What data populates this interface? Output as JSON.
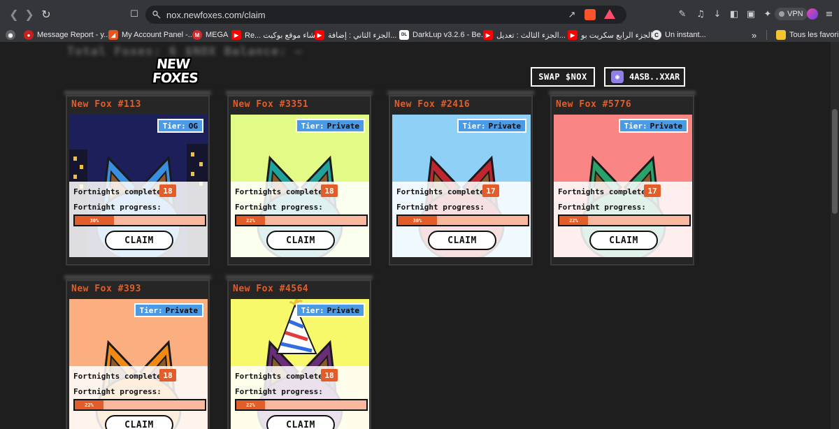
{
  "browser": {
    "url": "nox.newfoxes.com/claim",
    "vpn_label": "VPN",
    "bookmarks": [
      {
        "label": "Message Report - y...",
        "color": "#d93025",
        "glyph": "●"
      },
      {
        "label": "My Account Panel -...",
        "color": "#e8541d",
        "glyph": "◢"
      },
      {
        "label": "MEGA",
        "color": "#d9272e",
        "glyph": "M"
      },
      {
        "label": "Re... إنشاء موقع بوكيت",
        "color": "#ff0000",
        "glyph": "▶"
      },
      {
        "label": "الجزء الثاني : إضافة...",
        "color": "#ff0000",
        "glyph": "▶"
      },
      {
        "label": "DarkLup v3.2.6 - Be...",
        "color": "#ffffff",
        "glyph": "DL"
      },
      {
        "label": "الجزء الثالث : تعديل...",
        "color": "#ff0000",
        "glyph": "▶"
      },
      {
        "label": "الجزء الرابع سكريت بو...",
        "color": "#ff0000",
        "glyph": "▶"
      },
      {
        "label": "Un instant...",
        "color": "#e8e8e8",
        "glyph": "C"
      }
    ],
    "more_label": "»",
    "all_bookmarks_label": "Tous les favoris"
  },
  "header": {
    "blurred_text": "Total Foxes: 6  $NOX Balance: —",
    "logo_line1": "NEW",
    "logo_line2": "FOXES",
    "swap_label": "SWAP $NOX",
    "wallet_label": "4ASB..XXAR"
  },
  "labels": {
    "tier_prefix": "Tier:",
    "fortnights_completed": "Fortnights completed:",
    "fortnight_progress": "Fortnight progress:",
    "claim": "CLAIM"
  },
  "foxes": [
    {
      "name": "New Fox #113",
      "tier": "OG",
      "fortnights": "18",
      "progress_label": "30%",
      "progress": 0.3,
      "bg": "#1d1f5a",
      "fur": "#3b8fe0",
      "night": true
    },
    {
      "name": "New Fox #3351",
      "tier": "Private",
      "fortnights": "18",
      "progress_label": "22%",
      "progress": 0.22,
      "bg": "#e2fb86",
      "fur": "#1fa39a",
      "night": false
    },
    {
      "name": "New Fox #2416",
      "tier": "Private",
      "fortnights": "17",
      "progress_label": "30%",
      "progress": 0.3,
      "bg": "#8fd0f7",
      "fur": "#c0262f",
      "night": false
    },
    {
      "name": "New Fox #5776",
      "tier": "Private",
      "fortnights": "17",
      "progress_label": "22%",
      "progress": 0.22,
      "bg": "#fa8585",
      "fur": "#2aa36a",
      "night": false
    },
    {
      "name": "New Fox #393",
      "tier": "Private",
      "fortnights": "18",
      "progress_label": "22%",
      "progress": 0.22,
      "bg": "#fbae7f",
      "fur": "#f08a14",
      "night": false
    },
    {
      "name": "New Fox #4564",
      "tier": "Private",
      "fortnights": "18",
      "progress_label": "22%",
      "progress": 0.22,
      "bg": "#f7f86a",
      "fur": "#6a2e79",
      "night": false,
      "hat": true
    }
  ]
}
